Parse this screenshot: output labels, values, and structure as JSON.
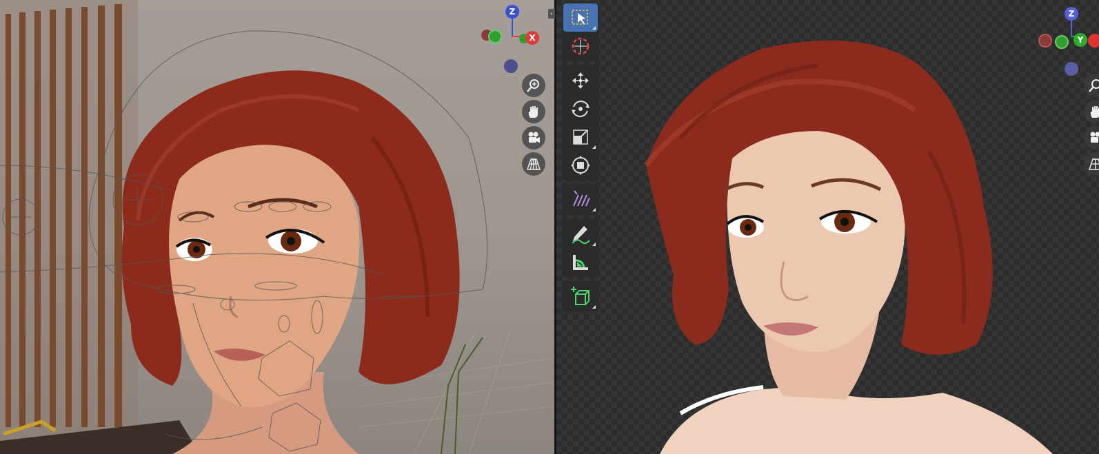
{
  "left_viewport": {
    "gizmo": {
      "z_label": "Z",
      "x_label": "X",
      "colors": {
        "z": "#3b4fd1",
        "x": "#e03b3b",
        "y": "#2f9e2f"
      }
    },
    "nav_icons": [
      "zoom-icon",
      "pan-hand-icon",
      "camera-view-icon",
      "perspective-grid-icon"
    ]
  },
  "right_viewport": {
    "gizmo": {
      "z_label": "Z",
      "y_label": "Y",
      "colors": {
        "z": "#5560d6",
        "x": "#d33",
        "y": "#2faa2f"
      }
    },
    "nav_icons": [
      "zoom-icon",
      "pan-hand-icon",
      "camera-view-icon",
      "perspective-grid-icon"
    ]
  },
  "collapse_arrow": "‹",
  "toolbar": {
    "tools": [
      {
        "name": "select-box-tool",
        "active": true
      },
      {
        "name": "cursor-tool",
        "active": false
      },
      {
        "name": "move-tool",
        "active": false
      },
      {
        "name": "rotate-tool",
        "active": false
      },
      {
        "name": "scale-tool",
        "active": false
      },
      {
        "name": "transform-tool",
        "active": false
      },
      {
        "name": "annotate-tool",
        "active": false
      },
      {
        "name": "draw-tool",
        "active": false
      },
      {
        "name": "measure-tool",
        "active": false
      },
      {
        "name": "add-cube-tool",
        "active": false
      }
    ],
    "accent": "#4772b3"
  }
}
